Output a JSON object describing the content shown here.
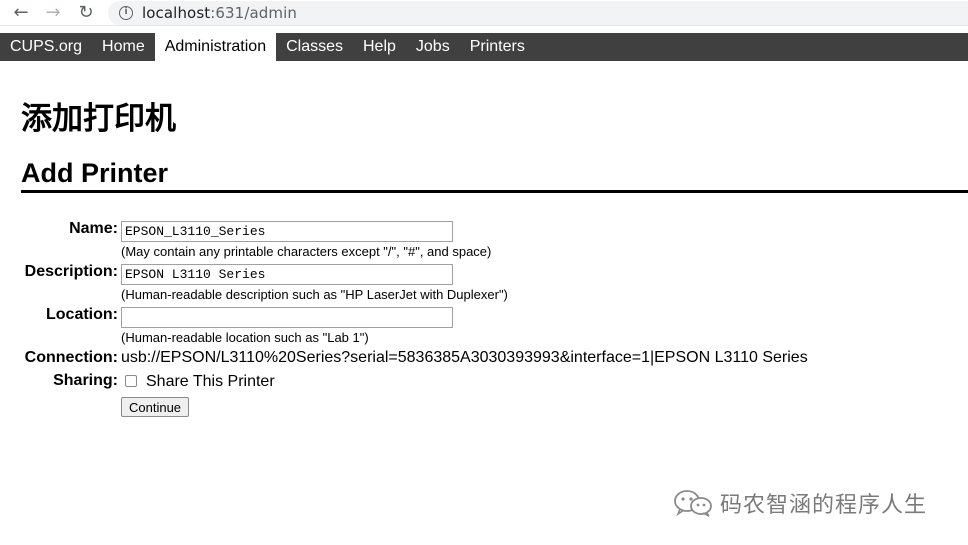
{
  "browser": {
    "url_host": "localhost",
    "url_path": ":631/admin"
  },
  "menu": {
    "items": [
      {
        "label": "CUPS.org"
      },
      {
        "label": "Home"
      },
      {
        "label": "Administration",
        "active": true
      },
      {
        "label": "Classes"
      },
      {
        "label": "Help"
      },
      {
        "label": "Jobs"
      },
      {
        "label": "Printers"
      }
    ]
  },
  "page": {
    "title": "添加打印机",
    "section_title": "Add Printer"
  },
  "form": {
    "name_label": "Name:",
    "name_value": "EPSON_L3110_Series",
    "name_hint": "(May contain any printable characters except \"/\", \"#\", and space)",
    "description_label": "Description:",
    "description_value": "EPSON L3110 Series",
    "description_hint": "(Human-readable description such as \"HP LaserJet with Duplexer\")",
    "location_label": "Location:",
    "location_value": "",
    "location_hint": "(Human-readable location such as \"Lab 1\")",
    "connection_label": "Connection:",
    "connection_value": "usb://EPSON/L3110%20Series?serial=5836385A3030393993&interface=1|EPSON L3110 Series",
    "sharing_label": "Sharing:",
    "sharing_checkbox_label": "Share This Printer",
    "sharing_checked": false,
    "continue_label": "Continue"
  },
  "watermark": {
    "text": "码农智涵的程序人生"
  }
}
